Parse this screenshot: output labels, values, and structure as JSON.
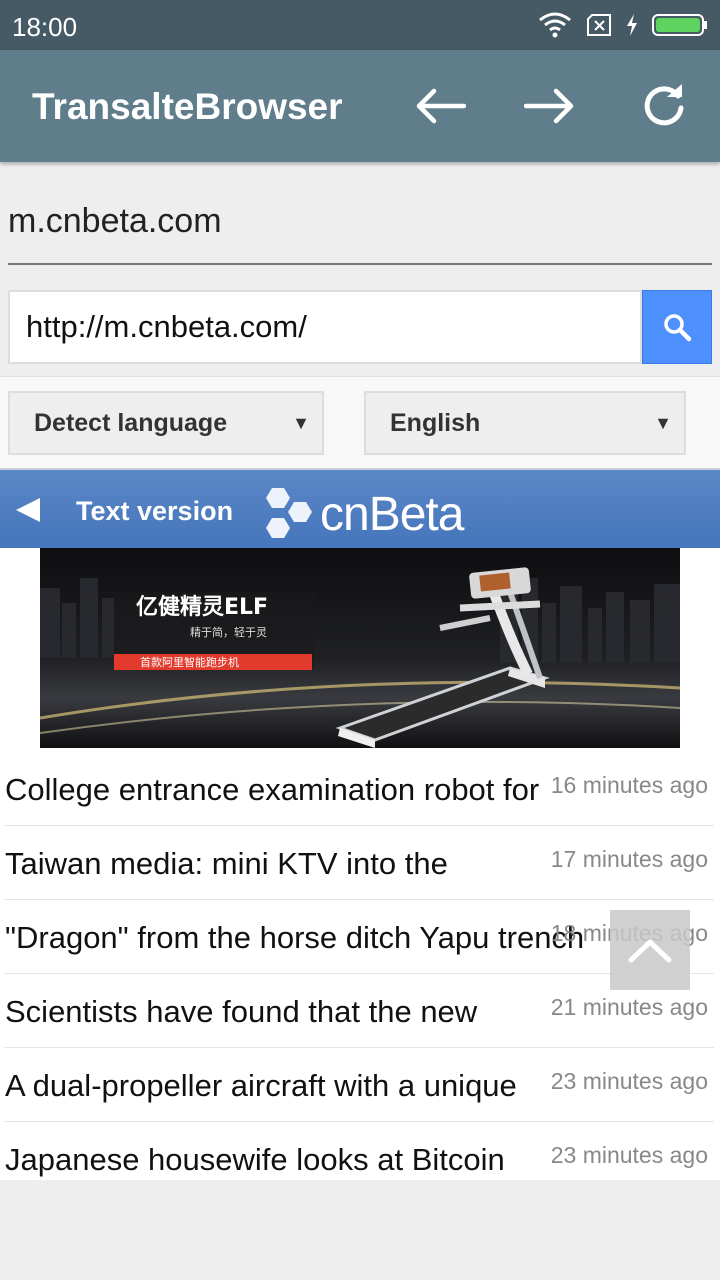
{
  "status_bar": {
    "time": "18:00"
  },
  "app_bar": {
    "title": "TransalteBrowser"
  },
  "address": {
    "site_name": "m.cnbeta.com",
    "url_value": "http://m.cnbeta.com/"
  },
  "language": {
    "source": "Detect language",
    "target": "English"
  },
  "page": {
    "text_version": "Text version",
    "logo_text": "cnBeta",
    "banner": {
      "title": "亿健精灵ELF",
      "subtitle": "精于简，轻于灵",
      "tagline": "首款阿里智能跑步机"
    },
    "news": [
      {
        "title": "College entrance examination robot for",
        "time": "16 minutes ago"
      },
      {
        "title": "Taiwan media: mini KTV into the",
        "time": "17 minutes ago"
      },
      {
        "title": "\"Dragon\" from the horse ditch Yapu trench",
        "time": "18 minutes ago"
      },
      {
        "title": "Scientists have found that the new",
        "time": "21 minutes ago"
      },
      {
        "title": "A dual-propeller aircraft with a unique",
        "time": "23 minutes ago"
      },
      {
        "title": "Japanese housewife looks at Bitcoin",
        "time": "23 minutes ago"
      }
    ]
  },
  "colors": {
    "status_bar": "#455a64",
    "app_bar": "#607d8b",
    "search_button": "#4d90fe",
    "cnbeta_header": "#4f7fc2",
    "battery": "#5fd35f"
  }
}
